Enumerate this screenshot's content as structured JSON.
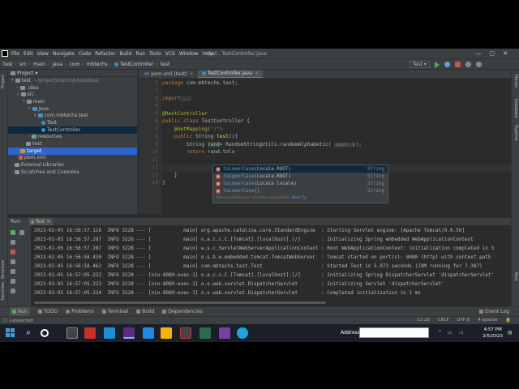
{
  "menubar": {
    "items": [
      "File",
      "Edit",
      "View",
      "Navigate",
      "Code",
      "Refactor",
      "Build",
      "Run",
      "Tools",
      "VCS",
      "Window",
      "Help"
    ],
    "title": "test - TestController.java"
  },
  "breadcrumbs": [
    "test",
    "src",
    "main",
    "java",
    "com",
    "mbtechs",
    "TestController",
    "test"
  ],
  "run_config": "Test",
  "project_panel": {
    "title": "Project",
    "tree": [
      {
        "label": "test",
        "suffix": "~/projects/spring-boot/test",
        "icon": "folder",
        "arrow": "▾",
        "indent": 0
      },
      {
        "label": ".idea",
        "icon": "folder",
        "arrow": "›",
        "indent": 1
      },
      {
        "label": "src",
        "icon": "folder",
        "arrow": "▾",
        "indent": 1
      },
      {
        "label": "main",
        "icon": "folder",
        "arrow": "▾",
        "indent": 2
      },
      {
        "label": "java",
        "icon": "src",
        "arrow": "▾",
        "indent": 3
      },
      {
        "label": "com.mbtechs.test",
        "icon": "src",
        "arrow": "▾",
        "indent": 4
      },
      {
        "label": "Test",
        "icon": "class",
        "arrow": "",
        "indent": 5
      },
      {
        "label": "TestController",
        "icon": "class",
        "arrow": "",
        "indent": 5,
        "selected": true
      },
      {
        "label": "resources",
        "icon": "folder",
        "arrow": "›",
        "indent": 3
      },
      {
        "label": "test",
        "icon": "folder",
        "arrow": "›",
        "indent": 2
      },
      {
        "label": "target",
        "icon": "target",
        "arrow": "›",
        "indent": 1,
        "highlight": true
      },
      {
        "label": "pom.xml",
        "icon": "maven",
        "arrow": "",
        "indent": 1
      },
      {
        "label": "External Libraries",
        "icon": "folder",
        "arrow": "›",
        "indent": 0
      },
      {
        "label": "Scratches and Consoles",
        "icon": "folder",
        "arrow": "›",
        "indent": 0
      }
    ]
  },
  "editor_tabs": [
    {
      "label": "pom.xml (test)",
      "prefix": "m",
      "active": false
    },
    {
      "label": "TestController.java",
      "prefix": "",
      "active": true
    }
  ],
  "code": {
    "line_numbers": [
      "1",
      "2",
      "3",
      "4",
      "5",
      "6",
      "7",
      "8",
      "9",
      "10",
      "11",
      "12",
      "13",
      "14"
    ],
    "package_kw": "package",
    "package_name": " com.mbtechs.test;",
    "import_kw": "import",
    "import_rest": " ...",
    "annotation_rest": "@RestController",
    "class_kw": "public class",
    "class_name": " TestController {",
    "getmapping": "@GetMapping(",
    "getmapping_arg": "\"/\"",
    "getmapping_end": ")",
    "method_kw": "public",
    "method_rest": " String ",
    "method_name": "test",
    "method_end": "(){",
    "var_line_start": "String ",
    "var_name": "rand",
    "var_line_mid": "= RandomStringUtils.",
    "var_line_call": "randomAlphabetic",
    "var_line_hint": "count: 6",
    "var_line_end": ");",
    "return_kw": "return",
    "return_rest": " rand.tolo",
    "close1": "}",
    "close2": "}"
  },
  "completion": {
    "items": [
      {
        "name": "toLowerCase",
        "args": "(Locale.ROOT)",
        "type": "String",
        "selected": true
      },
      {
        "name": "toUpperCase",
        "args": "(Locale.ROOT)",
        "type": "String",
        "selected": false
      },
      {
        "name": "toLowerCase",
        "args": "(Locale locale)",
        "type": "String",
        "selected": false
      },
      {
        "name": "toLowerCase",
        "args": "()",
        "type": "String",
        "selected": false
      }
    ],
    "footer": "Tab completion are currently unavailable.",
    "footer_link": "Next Tip"
  },
  "run_panel": {
    "label": "Run:",
    "tab": "Test",
    "logs": [
      "2023-02-05 16:56:57.116  INFO 3228 --- [           main] org.apache.catalina.core.StandardEngine  : Starting Servlet engine: [Apache Tomcat/9.0.56]",
      "2023-02-05 16:56:57.287  INFO 3228 --- [           main] o.a.c.c.C.[Tomcat].[localhost].[/]       : Initializing Spring embedded WebApplicationContext",
      "2023-02-05 16:56:57.287  INFO 3228 --- [           main] w.s.c.ServletWebServerApplicationContext : Root WebApplicationContext: initialization completed in 3",
      "2023-02-05 16:56:58.430  INFO 3228 --- [           main] o.s.b.w.embedded.tomcat.TomcatWebServer  : Tomcat started on port(s): 8080 (http) with context path",
      "2023-02-05 16:56:58.462  INFO 3228 --- [           main] com.mbtechs.test.Test                    : Started Test in 5.973 seconds (JVM running for 7.387)",
      "2023-02-05 16:57:05.222  INFO 3228 --- [nio-8080-exec-1] o.a.c.c.C.[Tomcat].[localhost].[/]       : Initializing Spring DispatcherServlet 'dispatcherServlet'",
      "2023-02-05 16:57:05.223  INFO 3228 --- [nio-8080-exec-1] o.s.web.servlet.DispatcherServlet        : Initializing Servlet 'dispatcherServlet'",
      "2023-02-05 16:57:05.224  INFO 3228 --- [nio-8080-exec-1] o.s.web.servlet.DispatcherServlet        : Completed initialization in 1 ms"
    ]
  },
  "bottom_tools": [
    "Run",
    "TODO",
    "Problems",
    "Terminal",
    "Build",
    "Dependencies"
  ],
  "event_log": "Event Log",
  "status": {
    "left": "☐ ↓expected",
    "position": "12:25",
    "line_sep": "CRLF",
    "encoding": "UTF-8",
    "indent": "4 spaces"
  },
  "side_labels": {
    "left": [
      "Project",
      "Structure",
      "Favorites"
    ],
    "right": [
      "Maven",
      "Database",
      "Pipeline",
      "Rest"
    ]
  },
  "taskbar": {
    "address_label": "Address",
    "time": "4:57 PM",
    "date": "2/5/2023"
  }
}
